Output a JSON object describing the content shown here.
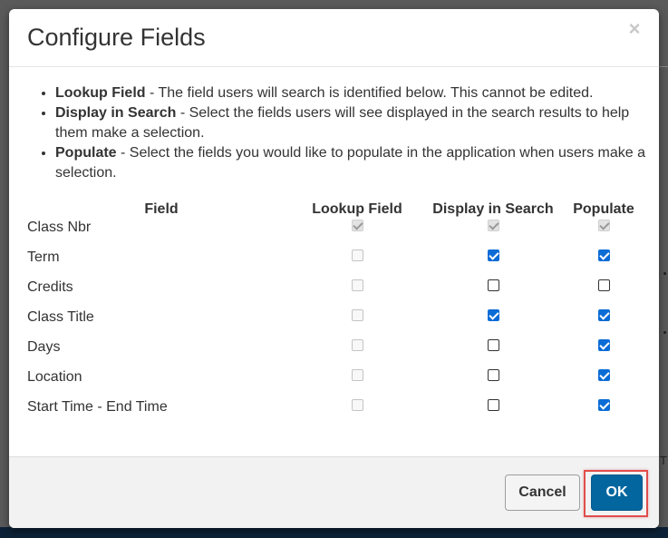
{
  "dialog": {
    "title": "Configure Fields",
    "close_symbol": "×"
  },
  "instructions": [
    {
      "term": "Lookup Field",
      "text": " - The field users will search is identified below. This cannot be edited."
    },
    {
      "term": "Display in Search",
      "text": " - Select the fields users will see displayed in the search results to help them make a selection."
    },
    {
      "term": "Populate",
      "text": " - Select the fields you would like to populate in the application when users make a selection."
    }
  ],
  "table": {
    "headers": [
      "Field",
      "Lookup Field",
      "Display in Search",
      "Populate"
    ],
    "rows": [
      {
        "field": "Class Nbr",
        "lookup": true,
        "display": true,
        "populate": true,
        "locked": true
      },
      {
        "field": "Term",
        "lookup": false,
        "display": true,
        "populate": true,
        "locked": false
      },
      {
        "field": "Credits",
        "lookup": false,
        "display": false,
        "populate": false,
        "locked": false
      },
      {
        "field": "Class Title",
        "lookup": false,
        "display": true,
        "populate": true,
        "locked": false
      },
      {
        "field": "Days",
        "lookup": false,
        "display": false,
        "populate": true,
        "locked": false
      },
      {
        "field": "Location",
        "lookup": false,
        "display": false,
        "populate": true,
        "locked": false
      },
      {
        "field": "Start Time - End Time",
        "lookup": false,
        "display": false,
        "populate": true,
        "locked": false
      }
    ]
  },
  "footer": {
    "cancel_label": "Cancel",
    "ok_label": "OK"
  },
  "colors": {
    "accent": "#0b6cd6",
    "ok_button": "#03669e",
    "highlight": "#e04d4d"
  },
  "background": {
    "edge_text": "T"
  }
}
